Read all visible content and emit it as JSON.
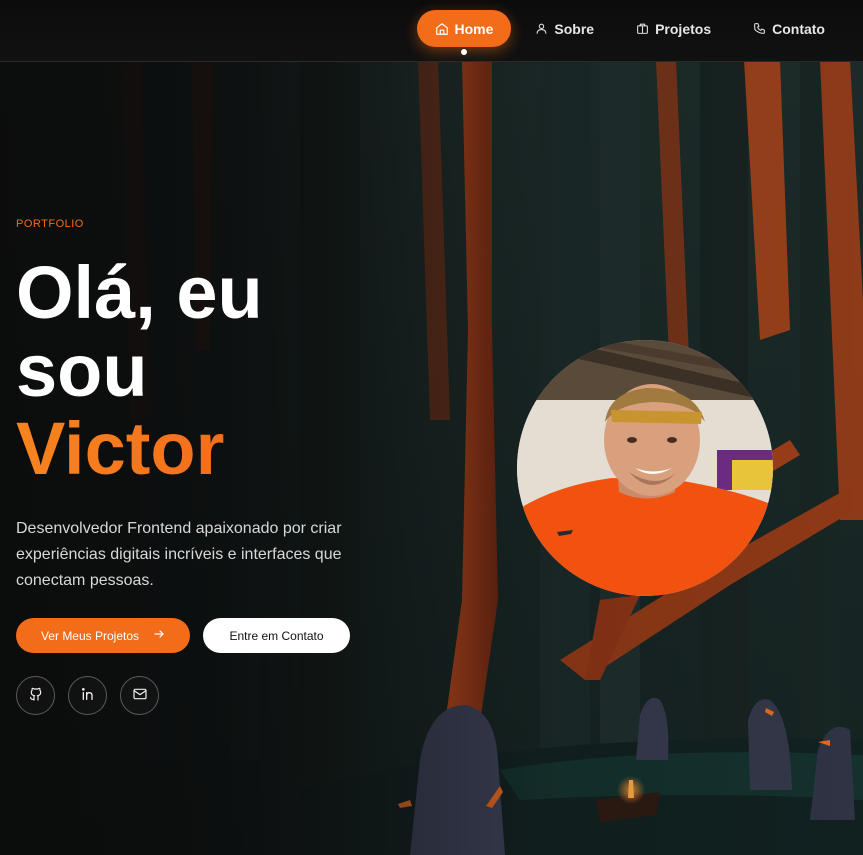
{
  "nav": {
    "items": [
      {
        "label": "Home",
        "icon": "home-icon",
        "active": true
      },
      {
        "label": "Sobre",
        "icon": "user-icon",
        "active": false
      },
      {
        "label": "Projetos",
        "icon": "briefcase-icon",
        "active": false
      },
      {
        "label": "Contato",
        "icon": "phone-icon",
        "active": false
      }
    ]
  },
  "hero": {
    "eyebrow": "PORTFOLIO",
    "line1": "Olá, eu",
    "line2": "sou",
    "name": "Victor",
    "bio": "Desenvolvedor Frontend apaixonado por criar experiências digitais incríveis e interfaces que conectam pessoas.",
    "primary_cta": "Ver Meus Projetos",
    "secondary_cta": "Entre em Contato"
  },
  "socials": [
    {
      "icon": "github-icon"
    },
    {
      "icon": "linkedin-icon"
    },
    {
      "icon": "mail-icon"
    }
  ],
  "colors": {
    "accent": "#f26c1a",
    "background": "#111111",
    "text": "#ffffff"
  }
}
